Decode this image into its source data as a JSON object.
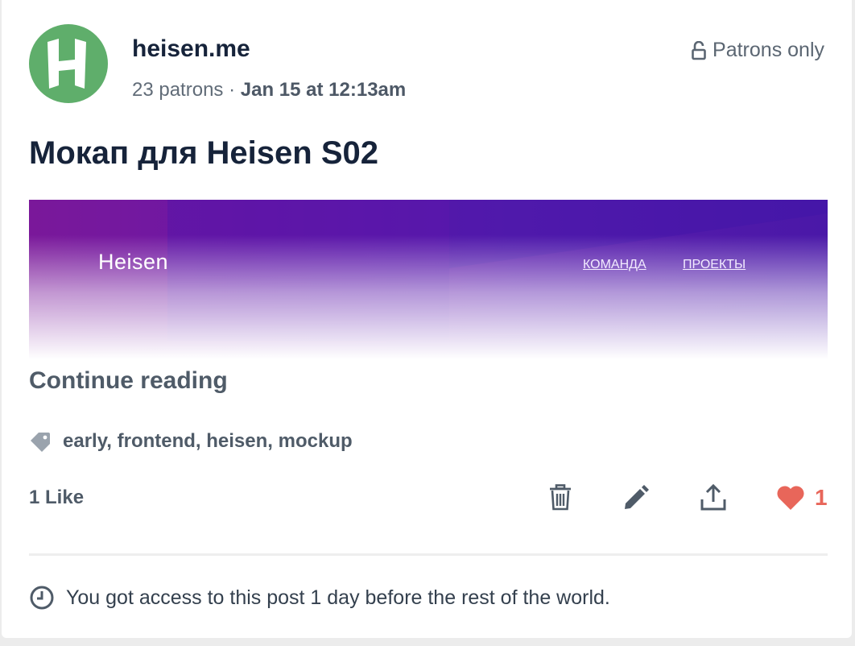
{
  "creator": {
    "avatar_letter": "H",
    "avatar_color": "#5fae6b",
    "name": "heisen.me",
    "patrons": "23 patrons",
    "separator": "·",
    "date": "Jan 15 at 12:13am"
  },
  "access": {
    "icon": "lock-icon",
    "label": "Patrons only"
  },
  "post": {
    "title": "Мокап для Heisen S02",
    "banner": {
      "brand": "Heisen",
      "nav": [
        "КОМАНДА",
        "ПРОЕКТЫ"
      ]
    },
    "continue_label": "Continue reading",
    "tags_icon": "tag-icon",
    "tags": "early, frontend, heisen, mockup",
    "likes_label": "1 Like",
    "heart_count": "1",
    "heart_color": "#e8665a"
  },
  "actions": {
    "icons": [
      "trash-icon",
      "pencil-icon",
      "share-icon",
      "heart-icon"
    ]
  },
  "footer": {
    "icon": "clock-icon",
    "text": "You got access to this post 1 day before the rest of the world."
  }
}
